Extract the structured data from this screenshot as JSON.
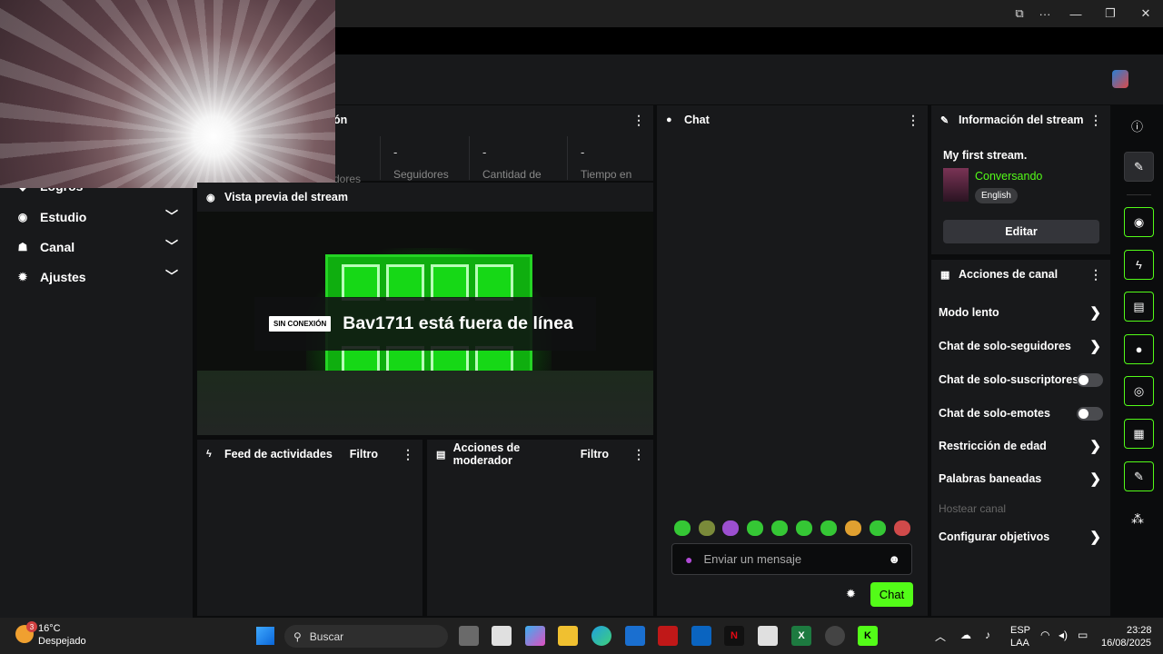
{
  "window": {
    "controls": {
      "ext": "⧉",
      "more": "···",
      "minimize": "—",
      "restore": "❐",
      "close": "✕"
    }
  },
  "sidebar": {
    "items": [
      {
        "label": "Logros"
      },
      {
        "label": "Estudio",
        "icon": "camera-icon"
      },
      {
        "label": "Canal",
        "icon": "people-icon"
      },
      {
        "label": "Ajustes",
        "icon": "gear-icon"
      }
    ]
  },
  "stats": {
    "header_fragment": "ón",
    "cards": [
      {
        "value": "-",
        "label": "Seguidores"
      },
      {
        "value": "-",
        "label": "Cantidad de"
      },
      {
        "value": "-",
        "label": "Tiempo en"
      }
    ],
    "prev_label_fragment": "dores"
  },
  "preview": {
    "title": "Vista previa del stream",
    "badge": "SIN CONEXIÓN",
    "status": "Bav1711 está fuera de línea"
  },
  "feed": {
    "title": "Feed de actividades",
    "filter": "Filtro"
  },
  "mod": {
    "title": "Acciones de moderador",
    "filter": "Filtro"
  },
  "chat": {
    "title": "Chat",
    "placeholder": "Enviar un mensaje",
    "send": "Chat"
  },
  "stream_info": {
    "title": "Información del stream",
    "stream_title": "My first stream.",
    "category": "Conversando",
    "language": "English",
    "edit": "Editar"
  },
  "channel_actions": {
    "title": "Acciones de canal",
    "rows": [
      {
        "label": "Modo lento",
        "type": "arrow"
      },
      {
        "label": "Chat de solo-seguidores",
        "type": "arrow"
      },
      {
        "label": "Chat de solo-suscriptores",
        "type": "toggle"
      },
      {
        "label": "Chat de solo-emotes",
        "type": "toggle"
      },
      {
        "label": "Restricción de edad",
        "type": "arrow"
      },
      {
        "label": "Palabras baneadas",
        "type": "arrow"
      },
      {
        "label": "Hostear canal",
        "type": "disabled"
      },
      {
        "label": "Configurar objetivos",
        "type": "arrow"
      }
    ]
  },
  "taskbar": {
    "weather_temp": "16°C",
    "weather_desc": "Despejado",
    "weather_badge": "3",
    "search": "Buscar",
    "lang_top": "ESP",
    "lang_bottom": "LAA",
    "time": "23:28",
    "date": "16/08/2025"
  },
  "colors": {
    "accent": "#53fc18",
    "panel": "#18191b",
    "bg": "#0b0c0d"
  }
}
